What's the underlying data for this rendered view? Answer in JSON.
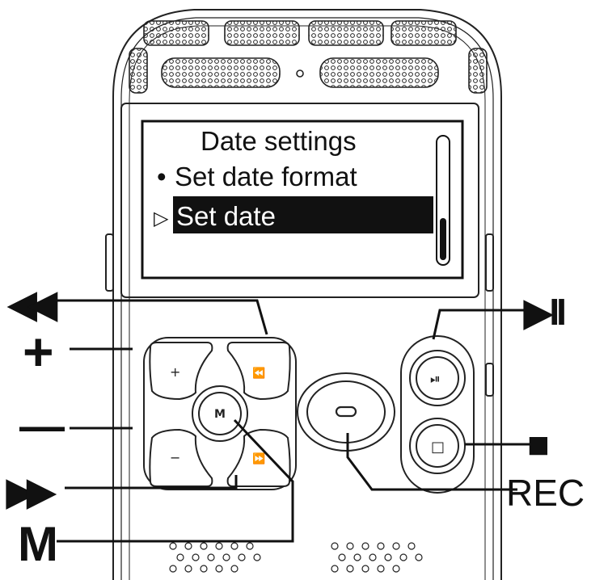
{
  "screen": {
    "title": "Date settings",
    "menu_items": [
      {
        "bullet": "•",
        "label": "Set date format",
        "selected": false
      },
      {
        "bullet": "▷",
        "label": "Set date",
        "selected": true
      }
    ]
  },
  "buttons": {
    "plus_glyph": "+",
    "minus_glyph": "−",
    "rewind_glyph": "⏪",
    "forward_glyph": "⏩",
    "menu_glyph": "M",
    "play_pause_glyph": "⏯",
    "stop_glyph": "□"
  },
  "callouts": {
    "rewind": "◀◀",
    "plus": "+",
    "minus": "—",
    "forward": "▶▶",
    "menu": "M",
    "play_pause": "▶II",
    "stop": "■",
    "rec": "REC"
  },
  "colors": {
    "ink": "#111111",
    "highlight_bg": "#111111",
    "highlight_fg": "#ffffff"
  }
}
